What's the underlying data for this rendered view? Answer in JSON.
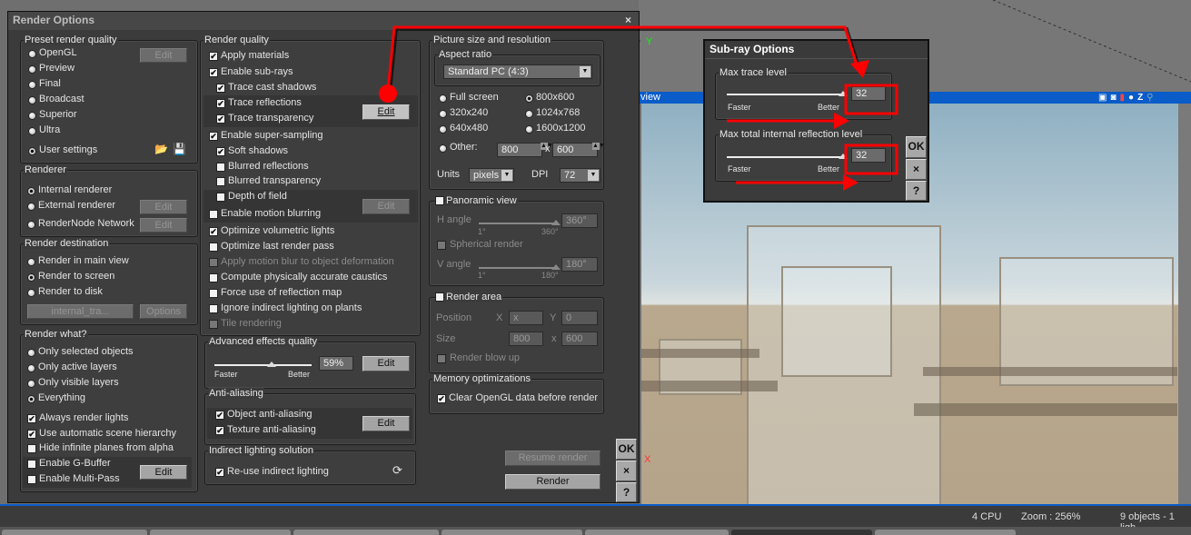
{
  "dialog": {
    "title": "Render Options",
    "close": "×"
  },
  "preset": {
    "title": "Preset render quality",
    "edit": "Edit",
    "options": [
      {
        "label": "OpenGL",
        "selected": false
      },
      {
        "label": "Preview",
        "selected": false
      },
      {
        "label": "Final",
        "selected": false
      },
      {
        "label": "Broadcast",
        "selected": false
      },
      {
        "label": "Superior",
        "selected": false
      },
      {
        "label": "Ultra",
        "selected": false
      },
      {
        "label": "User settings",
        "selected": true
      }
    ],
    "icons": [
      "open-folder-icon",
      "save-disk-icon"
    ]
  },
  "renderer": {
    "title": "Renderer",
    "edit": "Edit",
    "options": [
      {
        "label": "Internal renderer",
        "selected": true
      },
      {
        "label": "External renderer",
        "selected": false
      },
      {
        "label": "RenderNode Network",
        "selected": false
      }
    ]
  },
  "destination": {
    "title": "Render destination",
    "file_field": "internal_tra...",
    "options_button": "Options",
    "options": [
      {
        "label": "Render in main view",
        "selected": false
      },
      {
        "label": "Render to screen",
        "selected": true
      },
      {
        "label": "Render to disk",
        "selected": false
      }
    ]
  },
  "render_what": {
    "title": "Render what?",
    "edit": "Edit",
    "options": [
      {
        "label": "Only selected objects",
        "selected": false
      },
      {
        "label": "Only active layers",
        "selected": false
      },
      {
        "label": "Only visible layers",
        "selected": false
      },
      {
        "label": "Everything",
        "selected": true
      }
    ],
    "checks": [
      {
        "label": "Always render lights",
        "checked": true
      },
      {
        "label": "Use automatic scene hierarchy",
        "checked": true
      },
      {
        "label": "Hide infinite planes from alpha",
        "checked": false
      },
      {
        "label": "Enable G-Buffer",
        "checked": false
      },
      {
        "label": "Enable Multi-Pass",
        "checked": false
      }
    ]
  },
  "render_quality": {
    "title": "Render quality",
    "edit": "Edit",
    "items": [
      {
        "label": "Apply materials",
        "checked": true,
        "disabled": false
      },
      {
        "label": "Enable sub-rays",
        "checked": true,
        "disabled": false
      },
      {
        "label": "Trace cast shadows",
        "checked": true,
        "disabled": false
      },
      {
        "label": "Trace reflections",
        "checked": true,
        "disabled": false
      },
      {
        "label": "Trace transparency",
        "checked": true,
        "disabled": false
      },
      {
        "label": "Enable super-sampling",
        "checked": true,
        "disabled": false
      },
      {
        "label": "Soft shadows",
        "checked": true,
        "disabled": false
      },
      {
        "label": "Blurred reflections",
        "checked": false,
        "disabled": false
      },
      {
        "label": "Blurred transparency",
        "checked": false,
        "disabled": false
      },
      {
        "label": "Depth of field",
        "checked": false,
        "disabled": false
      },
      {
        "label": "Enable motion blurring",
        "checked": false,
        "disabled": false
      },
      {
        "label": "Optimize volumetric lights",
        "checked": true,
        "disabled": false
      },
      {
        "label": "Optimize last render pass",
        "checked": false,
        "disabled": false
      },
      {
        "label": "Apply motion blur to object deformation",
        "checked": false,
        "disabled": true
      },
      {
        "label": "Compute physically accurate caustics",
        "checked": false,
        "disabled": false
      },
      {
        "label": "Force use of reflection map",
        "checked": false,
        "disabled": false
      },
      {
        "label": "Ignore indirect lighting on plants",
        "checked": false,
        "disabled": false
      },
      {
        "label": "Tile rendering",
        "checked": false,
        "disabled": true
      }
    ]
  },
  "advanced": {
    "title": "Advanced effects quality",
    "faster": "Faster",
    "better": "Better",
    "value": "59%",
    "level": 0.59,
    "edit": "Edit"
  },
  "antialias": {
    "title": "Anti-aliasing",
    "edit": "Edit",
    "items": [
      {
        "label": "Object anti-aliasing",
        "checked": true
      },
      {
        "label": "Texture anti-aliasing",
        "checked": true
      }
    ]
  },
  "indirect": {
    "title": "Indirect lighting solution",
    "items": [
      {
        "label": "Re-use indirect lighting",
        "checked": true
      }
    ],
    "icon": "refresh-icon"
  },
  "picture": {
    "title": "Picture size and resolution",
    "aspect_title": "Aspect ratio",
    "aspect_value": "Standard PC (4:3)",
    "options": [
      {
        "label": "Full screen",
        "selected": false
      },
      {
        "label": "800x600",
        "selected": true
      },
      {
        "label": "320x240",
        "selected": false
      },
      {
        "label": "1024x768",
        "selected": false
      },
      {
        "label": "640x480",
        "selected": false
      },
      {
        "label": "1600x1200",
        "selected": false
      },
      {
        "label": "Other:",
        "selected": false
      }
    ],
    "width": "800",
    "height": "600",
    "x": "x",
    "units_label": "Units",
    "units": "pixels",
    "dpi_label": "DPI",
    "dpi": "72"
  },
  "panoramic": {
    "title": "Panoramic view",
    "checked": false,
    "h_angle": "H angle",
    "h_min": "1°",
    "h_max": "360°",
    "h_value": "360°",
    "spherical": "Spherical render",
    "v_angle": "V angle",
    "v_min": "1°",
    "v_max": "180°",
    "v_value": "180°"
  },
  "render_area": {
    "title": "Render area",
    "checked": false,
    "position": "Position",
    "x_label": "X",
    "x": "x",
    "y_label": "Y",
    "y": "0",
    "size": "Size",
    "w": "800",
    "h": "600",
    "blow_up": "Render blow up"
  },
  "memory": {
    "title": "Memory optimizations",
    "items": [
      {
        "label": "Clear OpenGL data before render",
        "checked": true
      }
    ]
  },
  "actions": {
    "resume": "Resume render",
    "render": "Render",
    "ok": "OK",
    "cancel": "×",
    "help": "?"
  },
  "subray": {
    "title": "Sub-ray Options",
    "max_trace": "Max trace level",
    "max_trace_value": "32",
    "max_tir": "Max total internal reflection level",
    "max_tir_value": "32",
    "faster": "Faster",
    "better": "Better",
    "ok": "OK",
    "cancel": "×",
    "help": "?"
  },
  "viewport": {
    "label": "view",
    "axis_y": "Y",
    "axis_x": "X",
    "icons": [
      "camera-cube-icon",
      "render-camera-icon",
      "rgb-channel-icon",
      "alpha-channel-icon",
      "z-depth-icon",
      "zoom-icon"
    ]
  },
  "status": {
    "cpu": "4 CPU",
    "zoom": "Zoom : 256%",
    "objects": "9 objects - 1 ligh"
  },
  "colors": {
    "annotation": "#ff0000",
    "view_bar": "#0a5cc8"
  }
}
